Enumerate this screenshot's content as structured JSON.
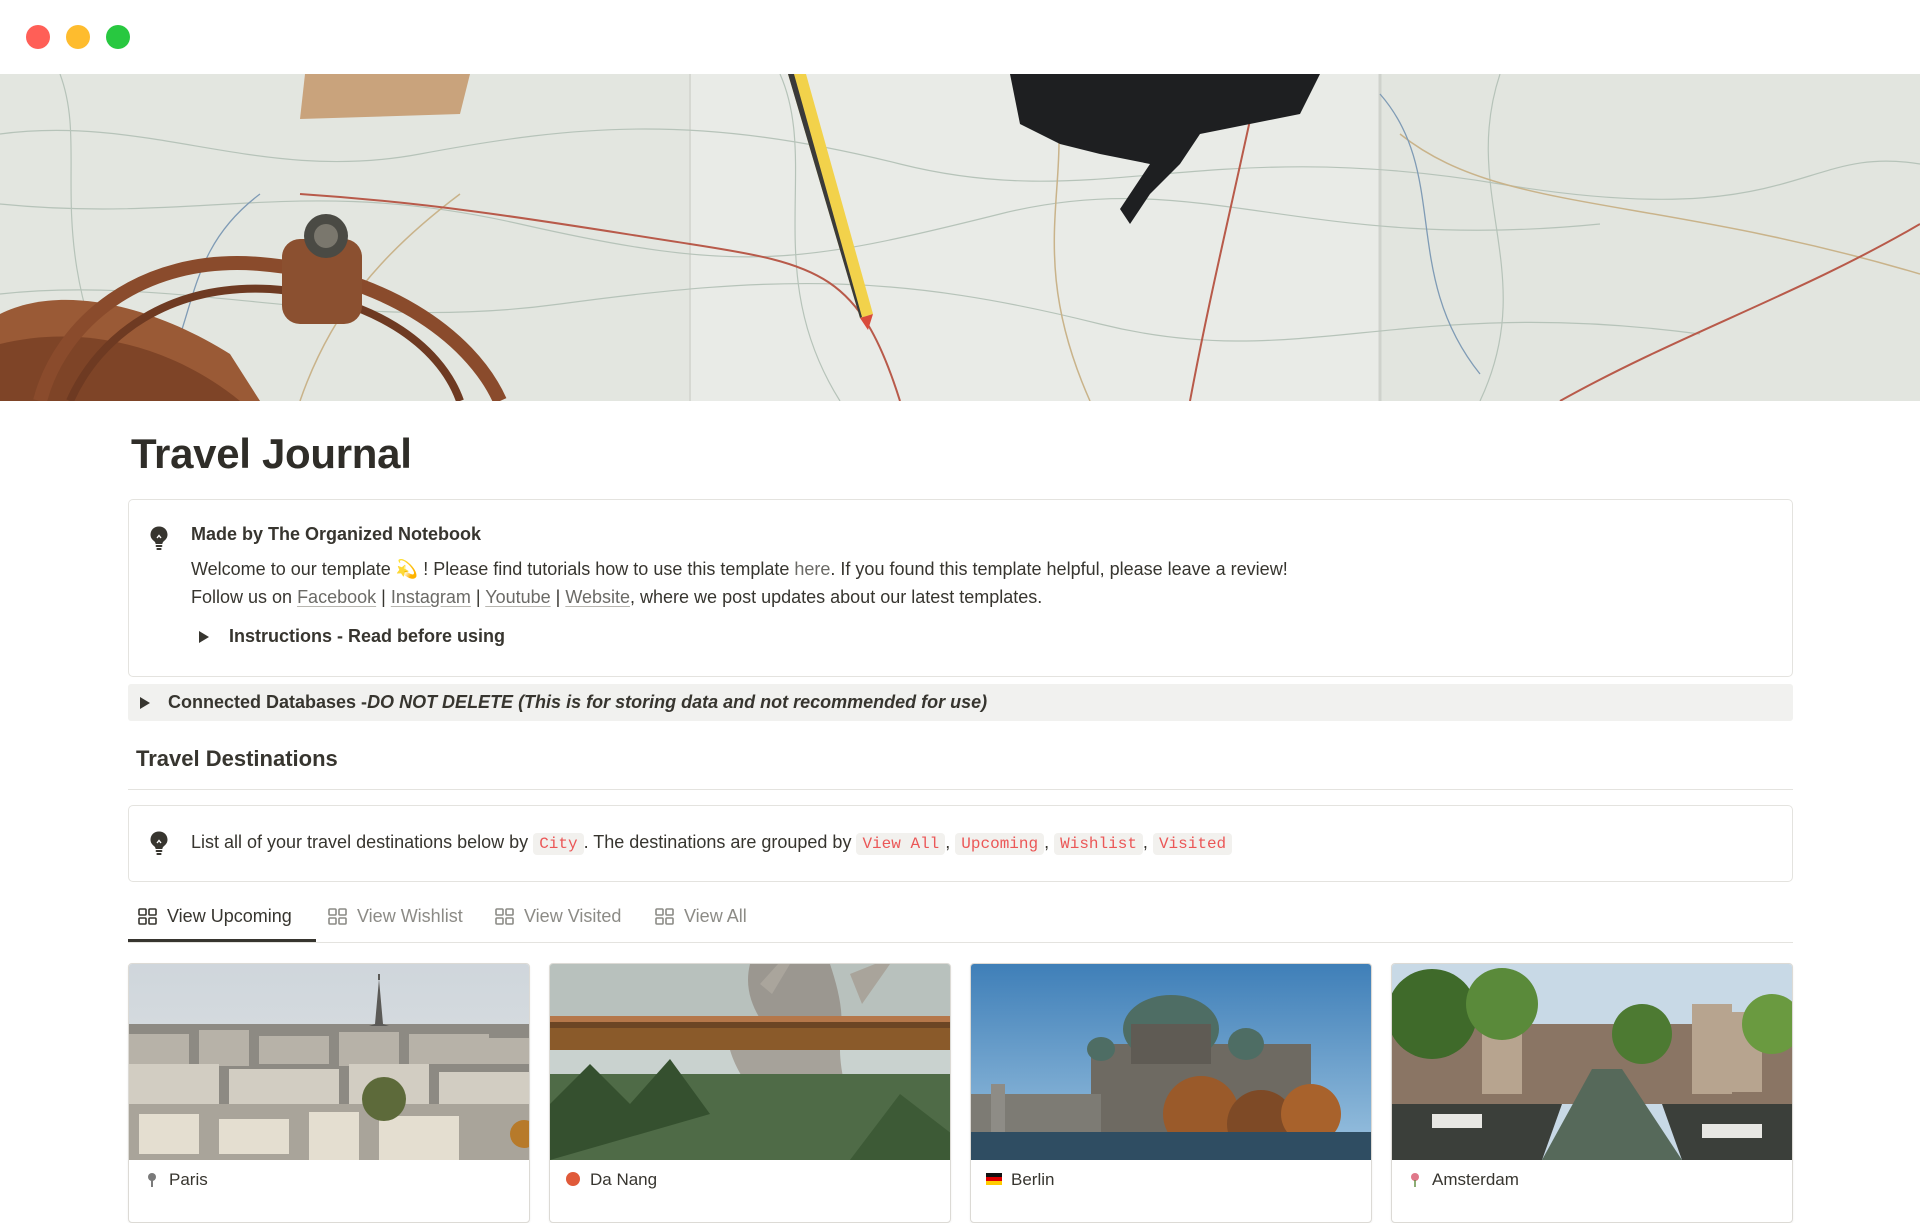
{
  "page": {
    "title": "Travel Journal"
  },
  "intro_callout": {
    "icon": "lightbulb-icon",
    "heading": "Made by The Organized Notebook",
    "line1_a": "Welcome to our template ",
    "line1_emoji": "💫",
    "line1_b": " ! Please find tutorials how to use this template ",
    "line1_link": "here",
    "line1_c": ". If you found this template helpful, please leave a review!",
    "line2_prefix": "Follow us on ",
    "links": [
      "Facebook",
      "Instagram",
      "Youtube",
      "Website"
    ],
    "separator": " | ",
    "line2_suffix": ", where we post updates about our latest templates.",
    "toggle_label": "Instructions - Read before using"
  },
  "databases_toggle": {
    "label_bold": "Connected Databases - ",
    "label_italic": "DO NOT DELETE (This is for storing data and not recommended for use)"
  },
  "section": {
    "heading": "Travel Destinations"
  },
  "destinations_callout": {
    "icon": "lightbulb-icon",
    "text_a": "List all of your travel destinations below by ",
    "code_city": "City",
    "text_b": ". The destinations are grouped by ",
    "groups": [
      "View All",
      "Upcoming",
      "Wishlist",
      "Visited"
    ],
    "comma": ", "
  },
  "tabs": [
    {
      "label": "View Upcoming",
      "active": true
    },
    {
      "label": "View Wishlist",
      "active": false
    },
    {
      "label": "View Visited",
      "active": false
    },
    {
      "label": "View All",
      "active": false
    }
  ],
  "cards": [
    {
      "title": "Paris"
    },
    {
      "title": "Da Nang"
    },
    {
      "title": "Berlin"
    },
    {
      "title": "Amsterdam"
    }
  ],
  "colors": {
    "text": "#37352f",
    "muted": "#8c8b86",
    "code_red": "#eb5757",
    "border": "#e4e3df",
    "toggle_bg": "#f1f1ef"
  }
}
